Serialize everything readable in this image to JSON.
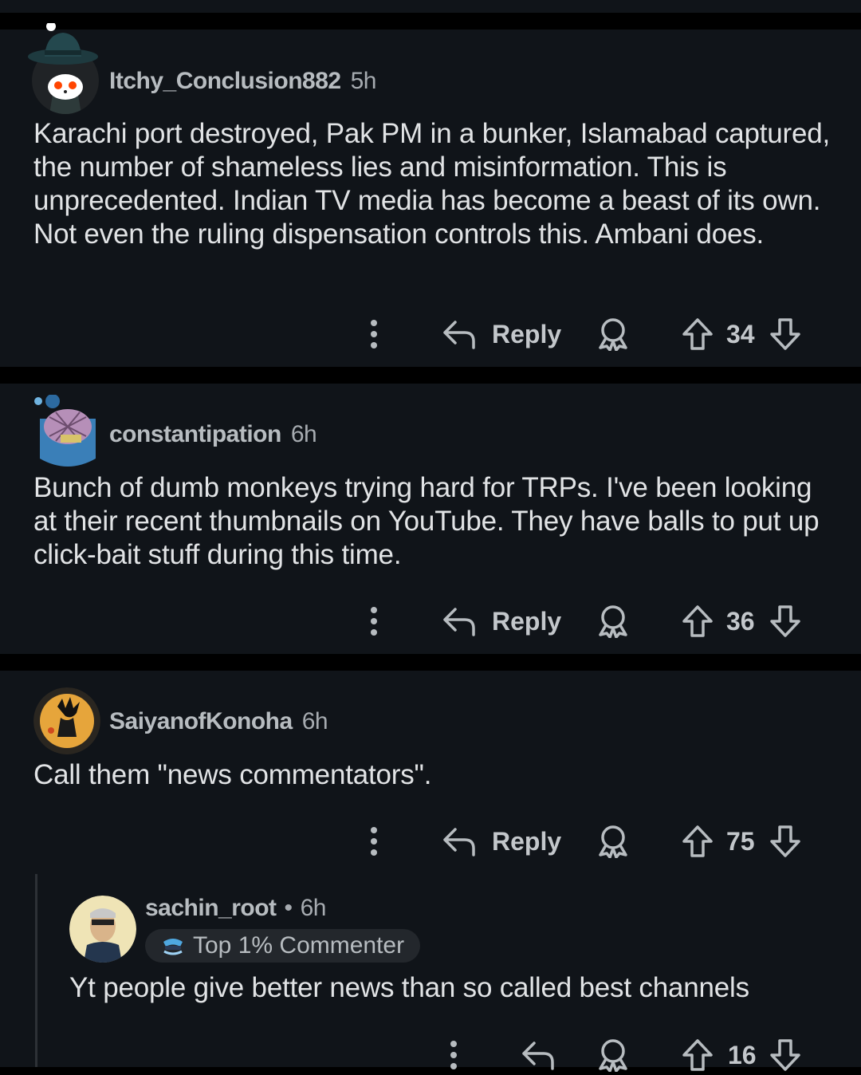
{
  "comments": [
    {
      "username": "Itchy_Conclusion882",
      "age": "5h",
      "avatar": "snoo-detective-avatar",
      "body": "Karachi port destroyed, Pak PM in a bunker, Islamabad captured, the number of shameless lies and misinformation. This is unprecedented. Indian TV media has become a beast of its own. Not even the ruling dispensation controls this. Ambani does.",
      "reply_label": "Reply",
      "score": "34"
    },
    {
      "username": "constantipation",
      "age": "6h",
      "avatar": "snoo-armored-avatar",
      "body": "Bunch of dumb monkeys trying hard for TRPs. I've been looking at their recent thumbnails on YouTube. They have balls to put up click-bait stuff during this time.",
      "reply_label": "Reply",
      "score": "36"
    },
    {
      "username": "SaiyanofKonoha",
      "age": "6h",
      "avatar": "dragon-ball-avatar",
      "body": "Call them \"news commentators\".",
      "reply_label": "Reply",
      "score": "75"
    }
  ],
  "reply": {
    "username": "sachin_root",
    "separator": "•",
    "age": "6h",
    "flair": "Top 1% Commenter",
    "avatar": "glasses-man-avatar",
    "body": "Yt people give better news than so called best channels",
    "score": "16"
  },
  "colors": {
    "background": "#000000",
    "card": "#101419",
    "text": "#e1e3e5",
    "muted": "#b7bcc0"
  }
}
